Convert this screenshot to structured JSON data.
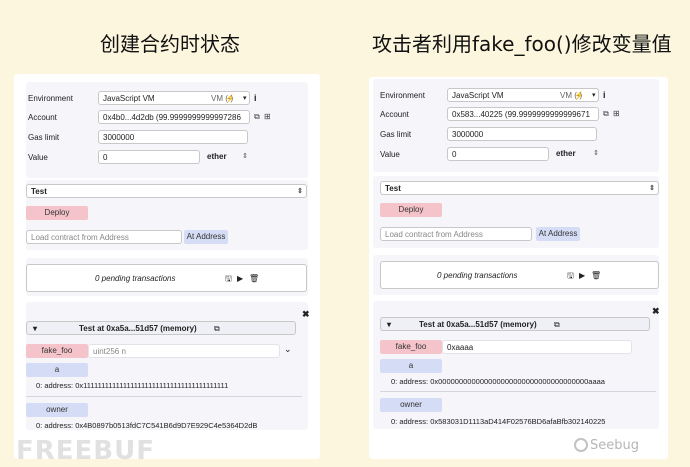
{
  "headings": {
    "left": "创建合约时状态",
    "right": "攻击者利用fake_foo()修改变量值"
  },
  "left": {
    "environment_label": "Environment",
    "environment_value": "JavaScript VM",
    "vm_badge": "VM (-)",
    "account_label": "Account",
    "account_value": "0x4b0...4d2db (99.9999999999997286",
    "gas_label": "Gas limit",
    "gas_value": "3000000",
    "value_label": "Value",
    "value_value": "0",
    "unit_value": "ether",
    "contract_select": "Test",
    "deploy_label": "Deploy",
    "load_placeholder": "Load contract from Address",
    "at_address_label": "At Address",
    "pending_text": "0 pending transactions",
    "instance_title": "Test at 0xa5a...51d57 (memory)",
    "fake_foo_label": "fake_foo",
    "fake_foo_placeholder": "uint256 n",
    "a_label": "a",
    "a_output": "0: address: 0x1111111111111111111111111111111111111111",
    "owner_label": "owner",
    "owner_output": "0: address: 0x4B0897b0513fdC7C541B6d9D7E929C4e5364D2dB"
  },
  "right": {
    "environment_label": "Environment",
    "environment_value": "JavaScript VM",
    "vm_badge": "VM (-)",
    "account_label": "Account",
    "account_value": "0x583...40225 (99.9999999999999671",
    "gas_label": "Gas limit",
    "gas_value": "3000000",
    "value_label": "Value",
    "value_value": "0",
    "unit_value": "ether",
    "contract_select": "Test",
    "deploy_label": "Deploy",
    "load_placeholder": "Load contract from Address",
    "at_address_label": "At Address",
    "pending_text": "0 pending transactions",
    "instance_title": "Test at 0xa5a...51d57 (memory)",
    "fake_foo_label": "fake_foo",
    "fake_foo_value": "0xaaaa",
    "a_label": "a",
    "a_output": "0: address: 0x000000000000000000000000000000000000aaaa",
    "owner_label": "owner",
    "owner_output": "0: address: 0x583031D1113aD414F02576BD6afaBfb302140225"
  },
  "watermarks": {
    "left": "FREEBUF",
    "right": "Seebug"
  },
  "icons": {
    "plug": "plug-icon",
    "info": "info-icon",
    "copy": "copy-icon",
    "plus": "plus-icon",
    "save": "save-icon",
    "play": "play-icon",
    "trash": "trash-icon",
    "close": "close-icon",
    "caret": "caret-icon",
    "chevron": "chevron-down-icon"
  }
}
